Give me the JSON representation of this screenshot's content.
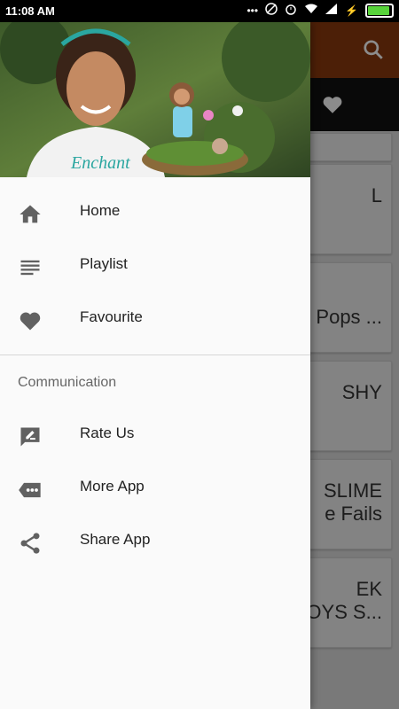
{
  "status_bar": {
    "time": "11:08 AM"
  },
  "drawer": {
    "menu": [
      {
        "label": "Home",
        "icon": "home-icon"
      },
      {
        "label": "Playlist",
        "icon": "playlist-icon"
      },
      {
        "label": "Favourite",
        "icon": "heart-icon"
      }
    ],
    "section_title": "Communication",
    "communication": [
      {
        "label": "Rate Us",
        "icon": "rate-icon"
      },
      {
        "label": "More App",
        "icon": "more-icon"
      },
      {
        "label": "Share App",
        "icon": "share-icon"
      }
    ]
  },
  "background": {
    "cards": [
      {
        "line1": "L",
        "line2": ""
      },
      {
        "line1": "i Pops ...",
        "line2": ""
      },
      {
        "line1": "SHY",
        "line2": ""
      },
      {
        "line1": "SLIME",
        "line2": "e Fails"
      },
      {
        "line1": "EK",
        "line2": "OYS S..."
      }
    ]
  },
  "colors": {
    "toolbar": "#8b3a0e",
    "tabbar": "#121212",
    "battery": "#58d43b"
  }
}
